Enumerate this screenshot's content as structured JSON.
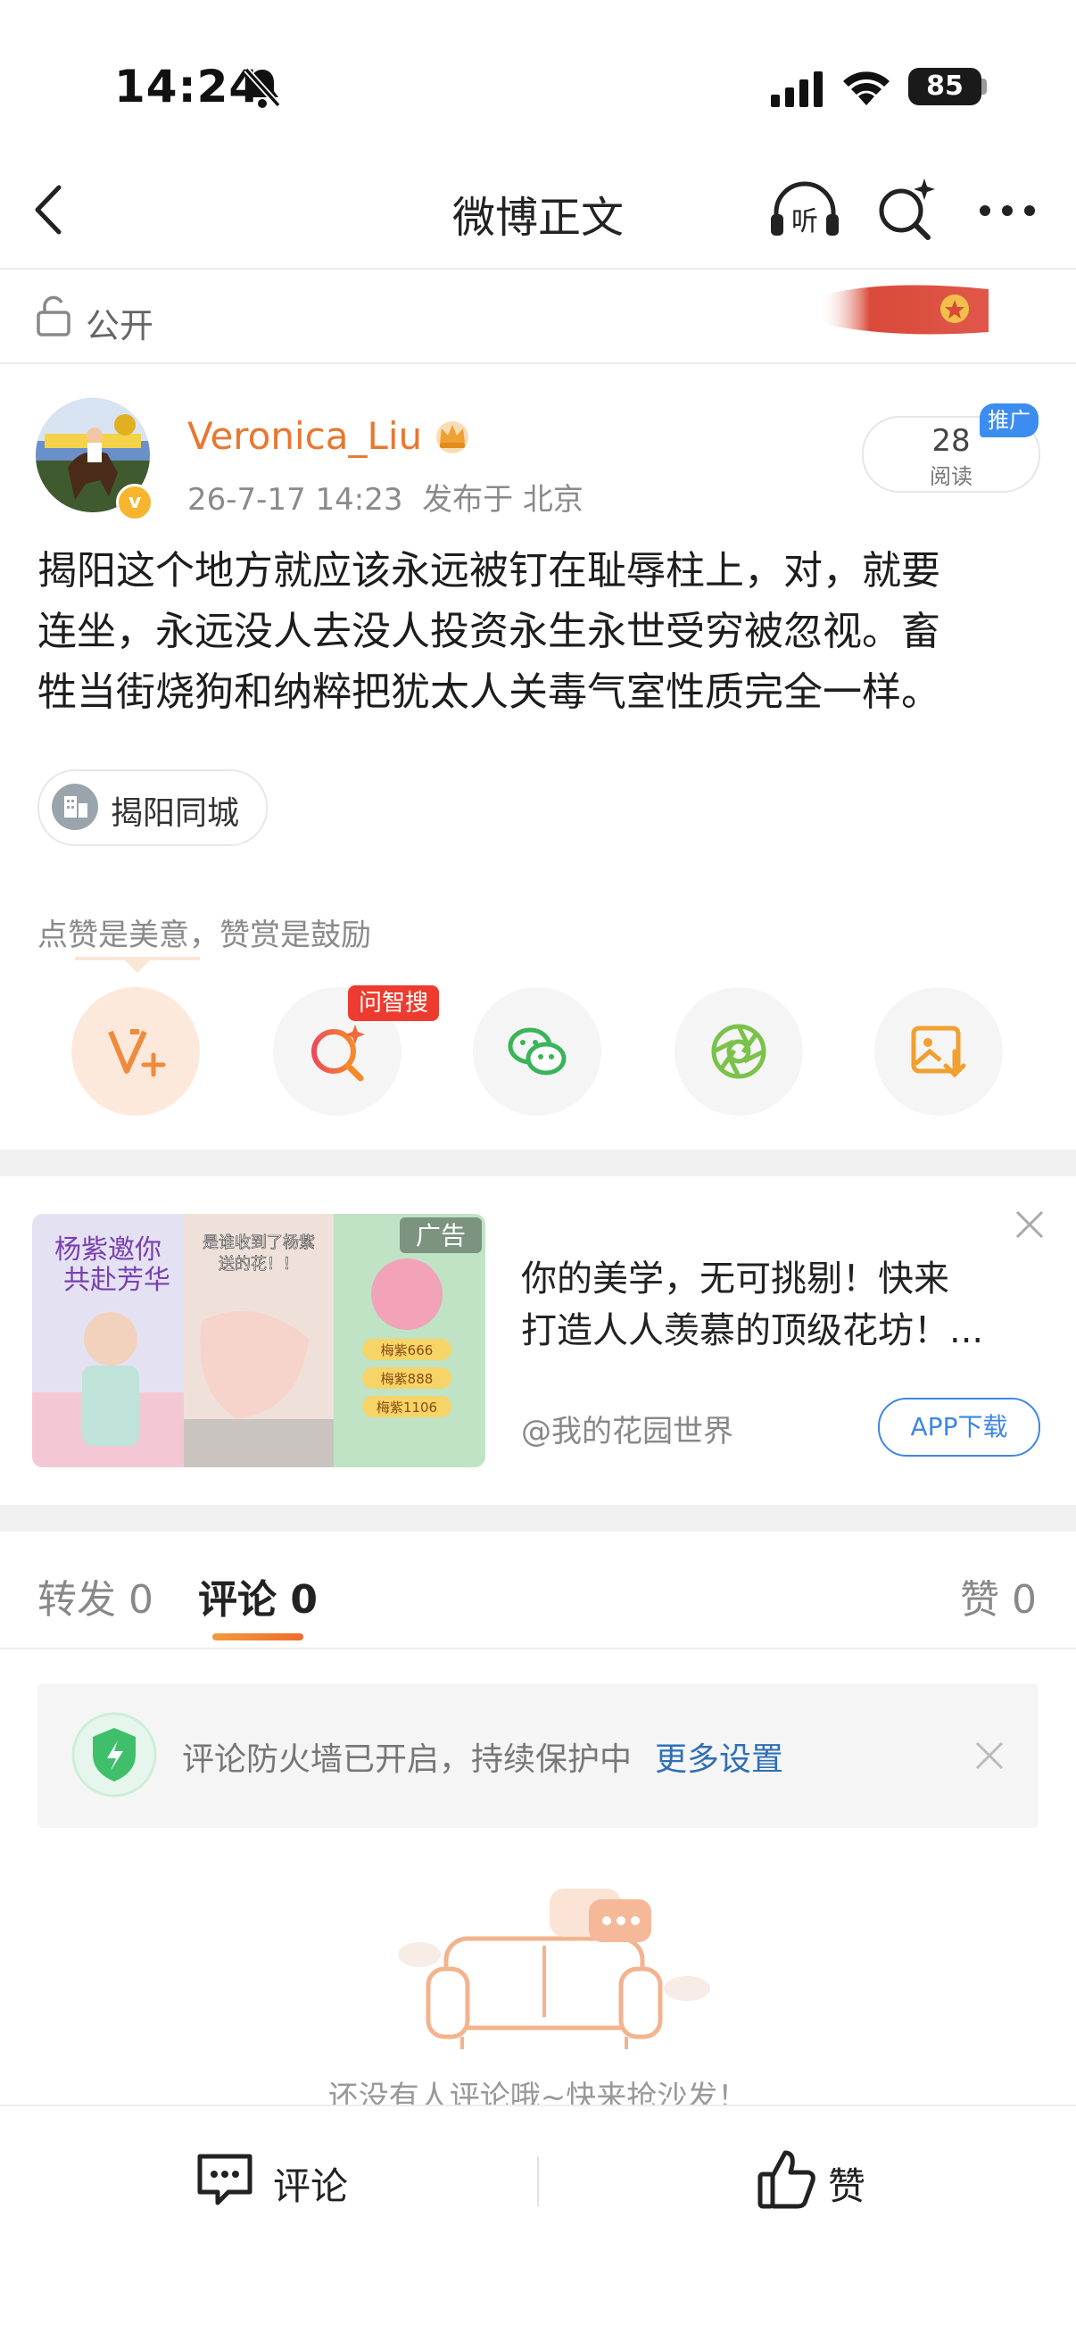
{
  "status_bar": {
    "time": "14:24",
    "battery": "85"
  },
  "nav": {
    "title": "微博正文"
  },
  "visibility": {
    "label": "公开"
  },
  "post": {
    "username": "Veronica_Liu",
    "meta": "26-7-17 14:23  发布于 北京",
    "reads_count": "28",
    "reads_label": "阅读",
    "promo_badge": "推广",
    "content_lines": [
      "揭阳这个地方就应该永远被钉在耻辱柱上，对，就要",
      "连坐，永远没人去没人投资永生永世受穷被忽视。畜",
      "牲当街烧狗和纳粹把犹太人关毒气室性质完全一样。"
    ],
    "tag": "揭阳同城",
    "reward_hint": "点赞是美意，赞赏是鼓励",
    "ask_badge": "问智搜"
  },
  "ad": {
    "title_lines": [
      "你的美学，无可挑剔！快来",
      "打造人人羡慕的顶级花坊！..."
    ],
    "source": "@我的花园世界",
    "button": "APP下载",
    "label": "广告",
    "image_texts": [
      "杨紫邀你",
      "共赴芳华",
      "是谁收到了杨紫",
      "送的花！！",
      "梅紫666",
      "梅紫888",
      "梅紫1106"
    ]
  },
  "tabs": [
    {
      "label": "转发",
      "count": "0"
    },
    {
      "label": "评论",
      "count": "0"
    },
    {
      "label": "赞",
      "count": "0"
    }
  ],
  "firewall": {
    "text": "评论防火墙已开启，持续保护中",
    "link": "更多设置"
  },
  "empty": {
    "text": "还没有人评论哦~快来抢沙发！"
  },
  "bottom_bar": {
    "comment": "评论",
    "like": "赞"
  },
  "colors": {
    "accent": "#e8772f",
    "link": "#2f6fb6",
    "promo": "#3d8cf0",
    "ask": "#ee3b2f"
  }
}
